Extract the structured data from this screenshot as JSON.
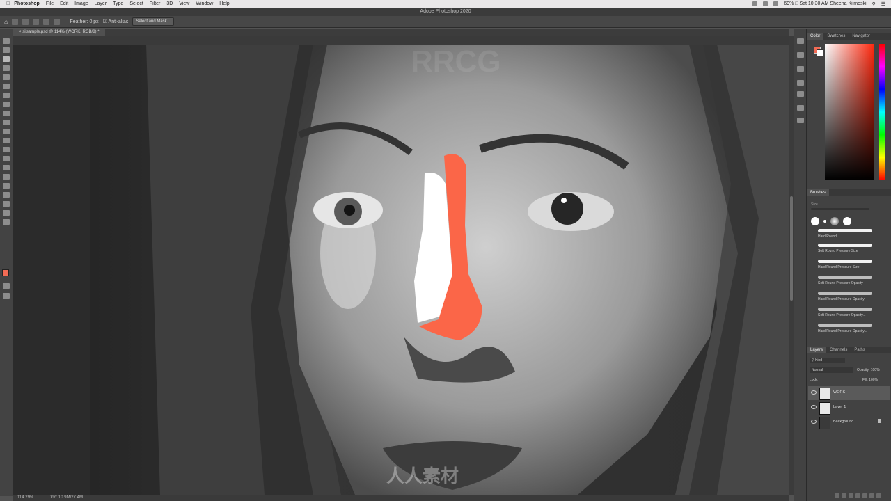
{
  "menubar": {
    "app_name": "Photoshop",
    "items": [
      "File",
      "Edit",
      "Image",
      "Layer",
      "Type",
      "Select",
      "Filter",
      "3D",
      "View",
      "Window",
      "Help"
    ],
    "status_text": "69% □  Sat 10:30 AM  Sheena Kilmoski"
  },
  "titlebar": {
    "title": "Adobe Photoshop 2020"
  },
  "options": {
    "feather_label": "Feather: 0 px",
    "antialias_label": "Anti-alias",
    "select_mask_label": "Select and Mask..."
  },
  "document": {
    "tab_title": "silsample.psd @ 114% (WORK, RGB/8) *",
    "zoom": "114.29%",
    "doc_info": "Doc: 10.9M/27.4M"
  },
  "panels": {
    "color_tabs": [
      "Color",
      "Swatches",
      "Navigator"
    ],
    "brushes_title": "Brushes",
    "brushes_size_label": "Size",
    "brushes": [
      "Hard Round",
      "Soft Round Pressure Size",
      "Hard Round Pressure Size",
      "Soft Round Pressure Opacity",
      "Hard Round Pressure Opacity",
      "Soft Round Pressure Opacity...",
      "Hard Round Pressure Opacity..."
    ],
    "layers_tabs": [
      "Layers",
      "Channels",
      "Paths"
    ],
    "kind_label": "Kind",
    "blend_mode": "Normal",
    "opacity_label": "Opacity:",
    "opacity_value": "100%",
    "lock_label": "Lock:",
    "fill_label": "Fill:",
    "fill_value": "100%",
    "layers": [
      "WORK",
      "Layer 1",
      "Background"
    ]
  },
  "colors": {
    "foreground": "#f26b55",
    "background": "#ffffff",
    "accent_paint": "#fb6648"
  },
  "watermark": {
    "text": "RRCG",
    "text2": "人人素材"
  }
}
